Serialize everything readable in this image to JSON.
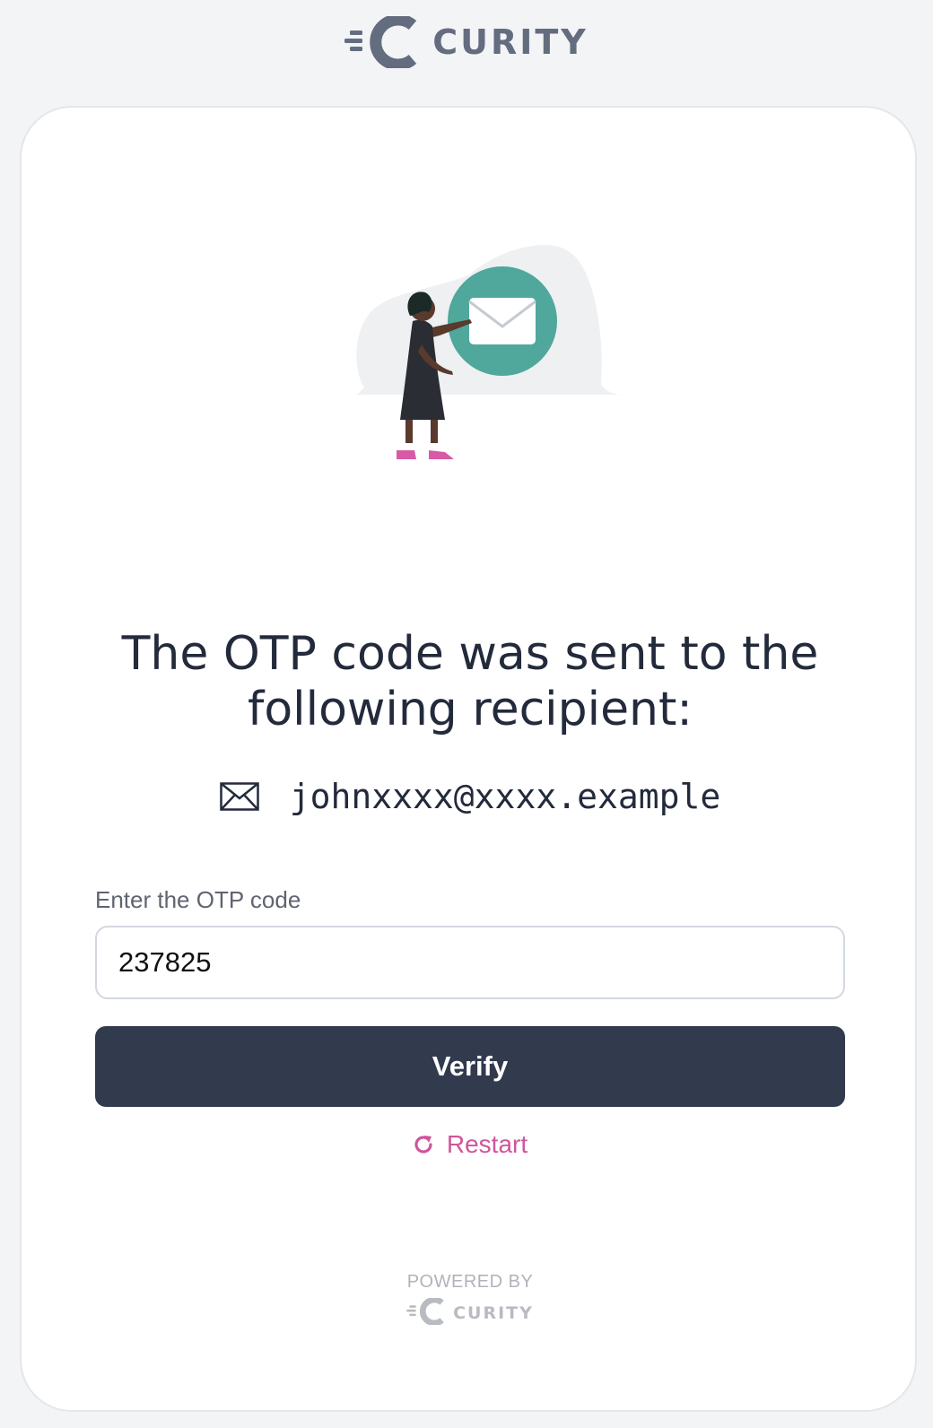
{
  "brand": {
    "name": "CURITY",
    "logo_icon": "curity-logo-icon",
    "color": "#646c7f"
  },
  "illustration": {
    "icon": "envelope-illustration",
    "accent_color": "#50a79c"
  },
  "heading": {
    "text": "The OTP code was sent to the following recipient:"
  },
  "recipient": {
    "icon": "envelope-icon",
    "value": "johnxxxx@xxxx.example"
  },
  "otp": {
    "label": "Enter the OTP code",
    "value": "237825"
  },
  "actions": {
    "verify_label": "Verify",
    "verify_color": "#323a4e",
    "restart_label": "Restart",
    "restart_icon": "refresh-icon",
    "restart_color": "#d1549b"
  },
  "footer": {
    "powered_by": "POWERED BY",
    "brand": "CURITY"
  }
}
